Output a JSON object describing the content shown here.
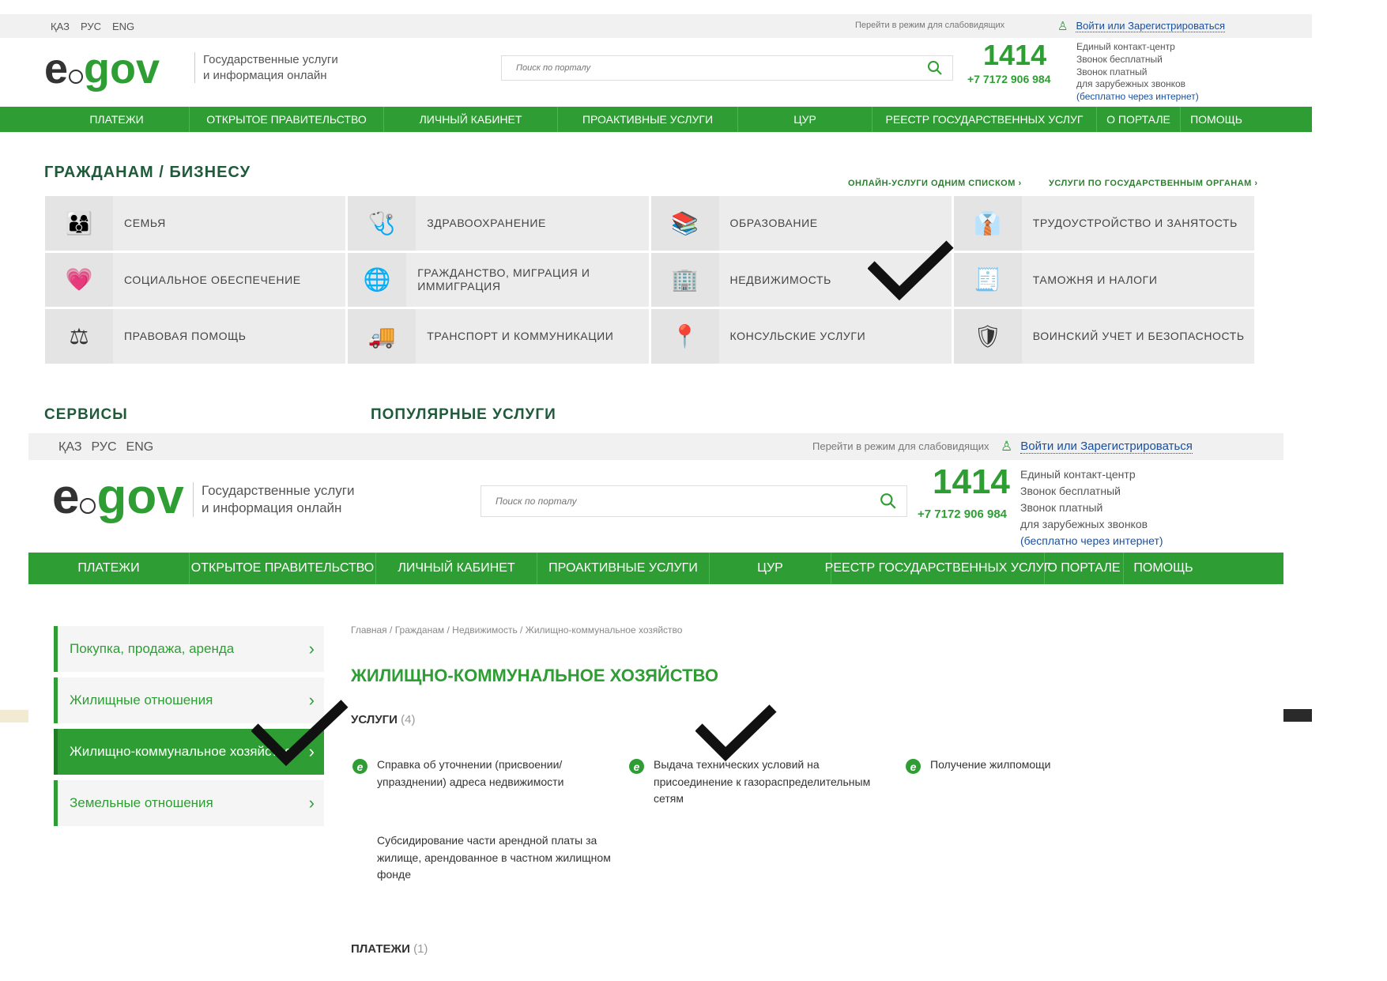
{
  "top": {
    "languages": [
      "ҚАЗ",
      "РУС",
      "ENG"
    ],
    "low_vision": "Перейти в режим для слабовидящих",
    "login": "Войти или Зарегистрироваться"
  },
  "header": {
    "logo_e": "e",
    "logo_gov": "gov",
    "tagline_line1": "Государственные услуги",
    "tagline_line2": "и информация онлайн",
    "search_placeholder": "Поиск по порталу",
    "phone_big": "1414",
    "phone_small": "+7 7172 906 984",
    "contact_lines": [
      "Единый контакт-центр",
      "Звонок бесплатный",
      "Звонок платный",
      "для зарубежных звонков"
    ],
    "contact_note": "(бесплатно через интернет)"
  },
  "nav": [
    "ПЛАТЕЖИ",
    "ОТКРЫТОЕ ПРАВИТЕЛЬСТВО",
    "ЛИЧНЫЙ КАБИНЕТ",
    "ПРОАКТИВНЫЕ УСЛУГИ",
    "ЦУР",
    "РЕЕСТР ГОСУДАРСТВЕННЫХ УСЛУГ",
    "О ПОРТАЛЕ",
    "ПОМОЩЬ"
  ],
  "categories_section": {
    "title": "ГРАЖДАНАМ / БИЗНЕСУ",
    "link_list": "ОНЛАЙН-УСЛУГИ ОДНИМ СПИСКОМ ›",
    "link_agencies": "УСЛУГИ ПО ГОСУДАРСТВЕННЫМ ОРГАНАМ ›",
    "items": [
      {
        "label": "Семья",
        "icon": "family-icon",
        "glyph": "👨‍👩‍👦"
      },
      {
        "label": "Здравоохранение",
        "icon": "health-icon",
        "glyph": "🩺"
      },
      {
        "label": "Образование",
        "icon": "education-icon",
        "glyph": "📚"
      },
      {
        "label": "Трудоустройство и занятость",
        "icon": "employment-icon",
        "glyph": "👔"
      },
      {
        "label": "Социальное обеспечение",
        "icon": "social-icon",
        "glyph": "💗"
      },
      {
        "label": "Гражданство, миграция и иммиграция",
        "icon": "migration-icon",
        "glyph": "🌐"
      },
      {
        "label": "Недвижимость",
        "icon": "realty-icon",
        "glyph": "🏢"
      },
      {
        "label": "Таможня и налоги",
        "icon": "customs-icon",
        "glyph": "🧾"
      },
      {
        "label": "Правовая помощь",
        "icon": "scales-icon",
        "glyph": "⚖"
      },
      {
        "label": "Транспорт и коммуникации",
        "icon": "truck-icon",
        "glyph": "🚚"
      },
      {
        "label": "Консульские услуги",
        "icon": "consular-icon",
        "glyph": "📍"
      },
      {
        "label": "Воинский учет и безопасность",
        "icon": "shield-icon",
        "glyph": "🛡"
      }
    ]
  },
  "services_title": "СЕРВИСЫ",
  "popular_title": "ПОПУЛЯРНЫЕ УСЛУГИ",
  "sidebar": [
    {
      "label": "Покупка, продажа, аренда",
      "active": false
    },
    {
      "label": "Жилищные отношения",
      "active": false
    },
    {
      "label": "Жилищно-коммунальное хозяйство",
      "active": true
    },
    {
      "label": "Земельные отношения",
      "active": false
    }
  ],
  "breadcrumb": [
    "Главная",
    "Гражданам",
    "Недвижимость",
    "Жилищно-коммунальное хозяйство"
  ],
  "page_title": "ЖИЛИЩНО-КОММУНАЛЬНОЕ ХОЗЯЙСТВО",
  "services_heading": {
    "label": "УСЛУГИ",
    "count": "(4)"
  },
  "services": [
    {
      "text": "Справка об уточнении (присвоении/ упразднении) адреса недвижимости",
      "online": true
    },
    {
      "text": "Выдача технических условий на присоединение к газораспределительным сетям",
      "online": true
    },
    {
      "text": "Получение жилпомощи",
      "online": true
    },
    {
      "text": "Субсидирование части арендной платы за жилище, арендованное в частном жилищном фонде",
      "online": false
    }
  ],
  "payments_heading": {
    "label": "ПЛАТЕЖИ",
    "count": "(1)"
  },
  "colors": {
    "brand_green": "#2e9e34",
    "link_blue": "#1a4f9c"
  }
}
